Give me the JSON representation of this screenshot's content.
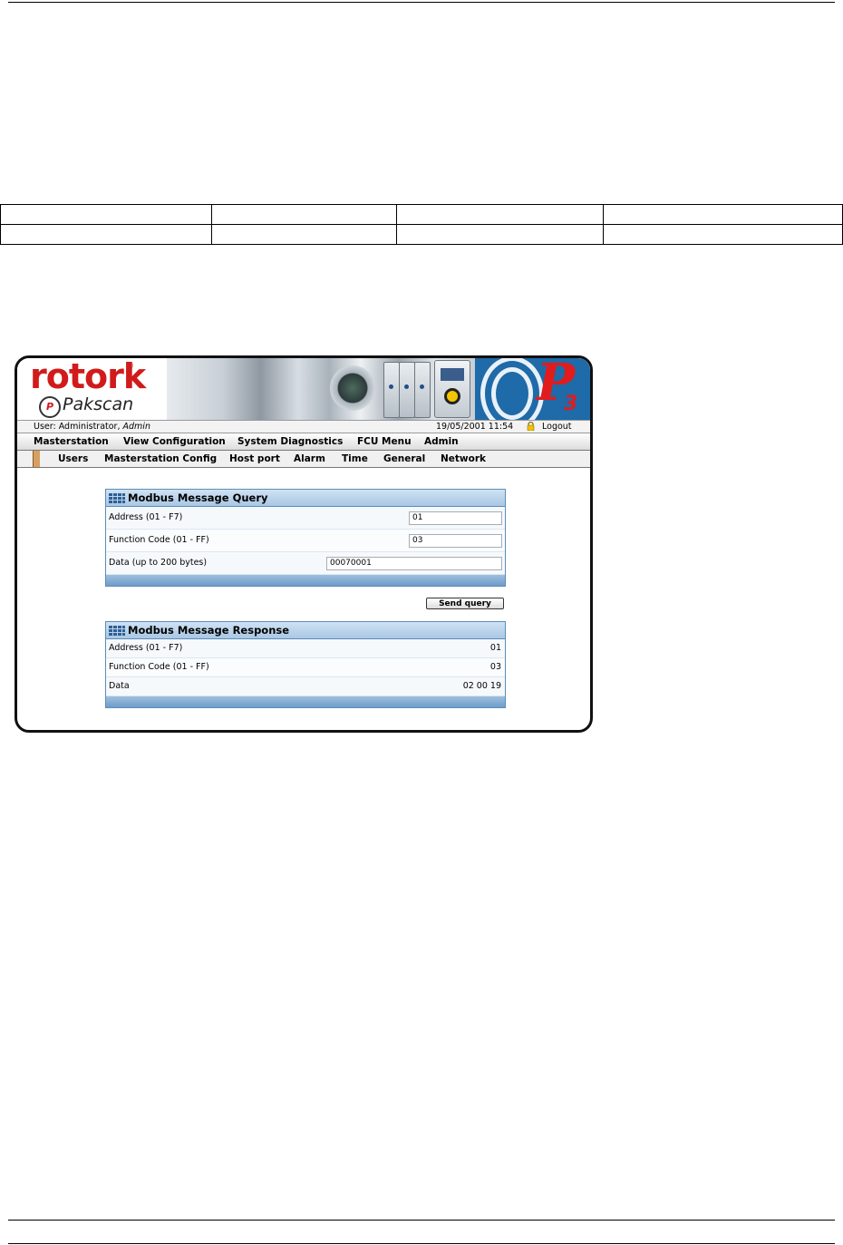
{
  "header": {
    "user_label": "User: Administrator, ",
    "user_role": "Admin",
    "datetime": "19/05/2001 11:54",
    "logout": "Logout"
  },
  "branding": {
    "company": "rotork",
    "registered": "®",
    "product": "Pakscan",
    "badge": "P",
    "p3_letter": "P",
    "p3_number": "3"
  },
  "main_menu": [
    "Masterstation",
    "View Configuration",
    "System Diagnostics",
    "FCU Menu",
    "Admin"
  ],
  "sub_menu": [
    "Users",
    "Masterstation Config",
    "Host port",
    "Alarm",
    "Time",
    "General",
    "Network"
  ],
  "query": {
    "title": "Modbus Message Query",
    "rows": [
      {
        "label": "Address (01 - F7)",
        "value": "01"
      },
      {
        "label": "Function Code (01 - FF)",
        "value": "03"
      },
      {
        "label": "Data (up to 200 bytes)",
        "value": "00070001"
      }
    ],
    "button": "Send query"
  },
  "response": {
    "title": "Modbus Message Response",
    "rows": [
      {
        "label": "Address (01 - F7)",
        "value": "01"
      },
      {
        "label": "Function Code (01 - FF)",
        "value": "03"
      },
      {
        "label": "Data",
        "value": "02 00 19"
      }
    ]
  },
  "colors": {
    "brand_red": "#d11b1b",
    "panel_blue": "#5b8db8",
    "p3_blue": "#1f6aa8"
  },
  "icons": [
    "lock-icon",
    "grid-icon"
  ]
}
